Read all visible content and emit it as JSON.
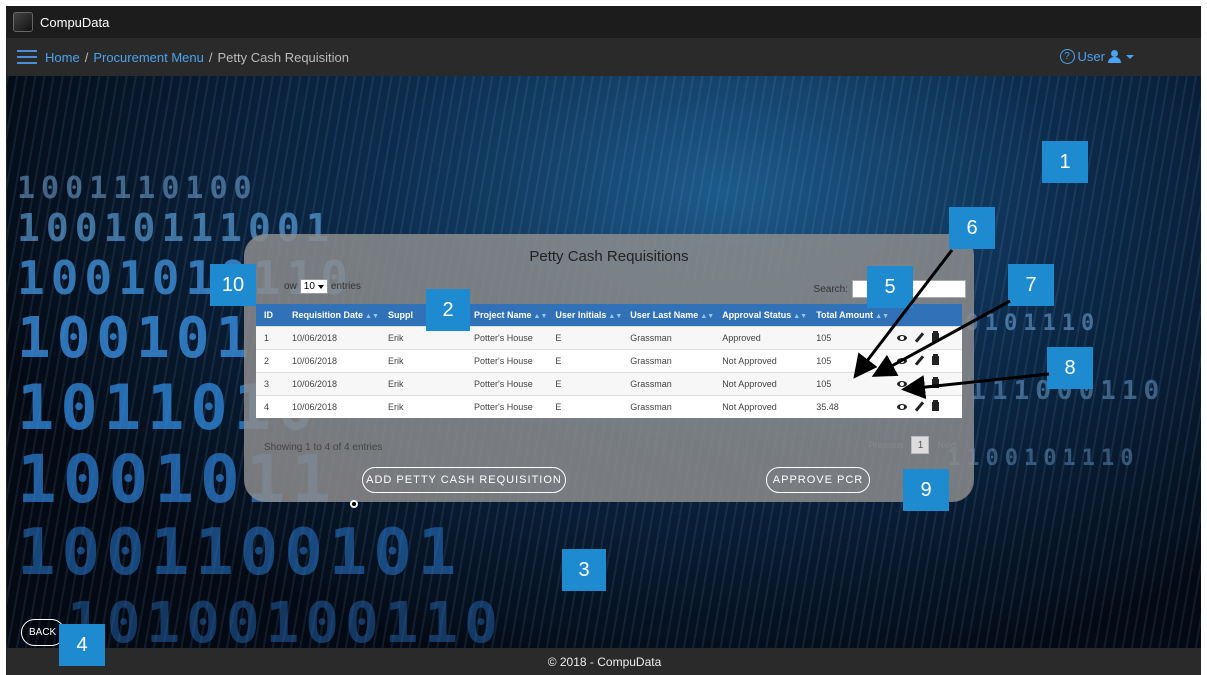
{
  "app": {
    "title": "CompuData"
  },
  "breadcrumb": {
    "home": "Home",
    "procurement": "Procurement Menu",
    "current": "Petty Cash Requisition",
    "separator": "/"
  },
  "user_menu": {
    "label": "User",
    "help_glyph": "?"
  },
  "panel": {
    "title": "Petty Cash Requisitions",
    "show_prefix": "ow",
    "entries_value": "10",
    "show_suffix": "entries",
    "search_label": "Search:",
    "columns": [
      "ID",
      "Requisition Date",
      "Suppl",
      "Project Name",
      "User Initials",
      "User Last Name",
      "Approval Status",
      "Total Amount",
      ""
    ],
    "rows": [
      {
        "id": "1",
        "date": "10/06/2018",
        "supplier": "Erik",
        "project": "Potter's House",
        "initials": "E",
        "last_name": "Grassman",
        "status": "Approved",
        "amount": "105"
      },
      {
        "id": "2",
        "date": "10/06/2018",
        "supplier": "Erik",
        "project": "Potter's House",
        "initials": "E",
        "last_name": "Grassman",
        "status": "Not Approved",
        "amount": "105"
      },
      {
        "id": "3",
        "date": "10/06/2018",
        "supplier": "Erik",
        "project": "Potter's House",
        "initials": "E",
        "last_name": "Grassman",
        "status": "Not Approved",
        "amount": "105"
      },
      {
        "id": "4",
        "date": "10/06/2018",
        "supplier": "Erik",
        "project": "Potter's House",
        "initials": "E",
        "last_name": "Grassman",
        "status": "Not Approved",
        "amount": "35.48"
      }
    ],
    "info": "Showing 1 to 4 of 4 entries",
    "pager": {
      "previous": "Previous",
      "page": "1",
      "next": "Next"
    },
    "add_button": "ADD PETTY CASH REQUISITION",
    "approve_button": "APPROVE PCR"
  },
  "back_button": "BACK",
  "footer": "© 2018 - CompuData",
  "markers": [
    "1",
    "2",
    "3",
    "4",
    "5",
    "6",
    "7",
    "8",
    "9",
    "10"
  ],
  "background_digits": [
    "1001110100",
    "10010111001",
    "1001010110",
    "1001011",
    "1011010",
    "1001011",
    "1001100101",
    "10100100110",
    "110101110",
    "10111000110",
    "1100101110"
  ],
  "colors": {
    "accent": "#4aa3f0",
    "table_header": "#3071b8",
    "marker": "#1e8bd1"
  }
}
